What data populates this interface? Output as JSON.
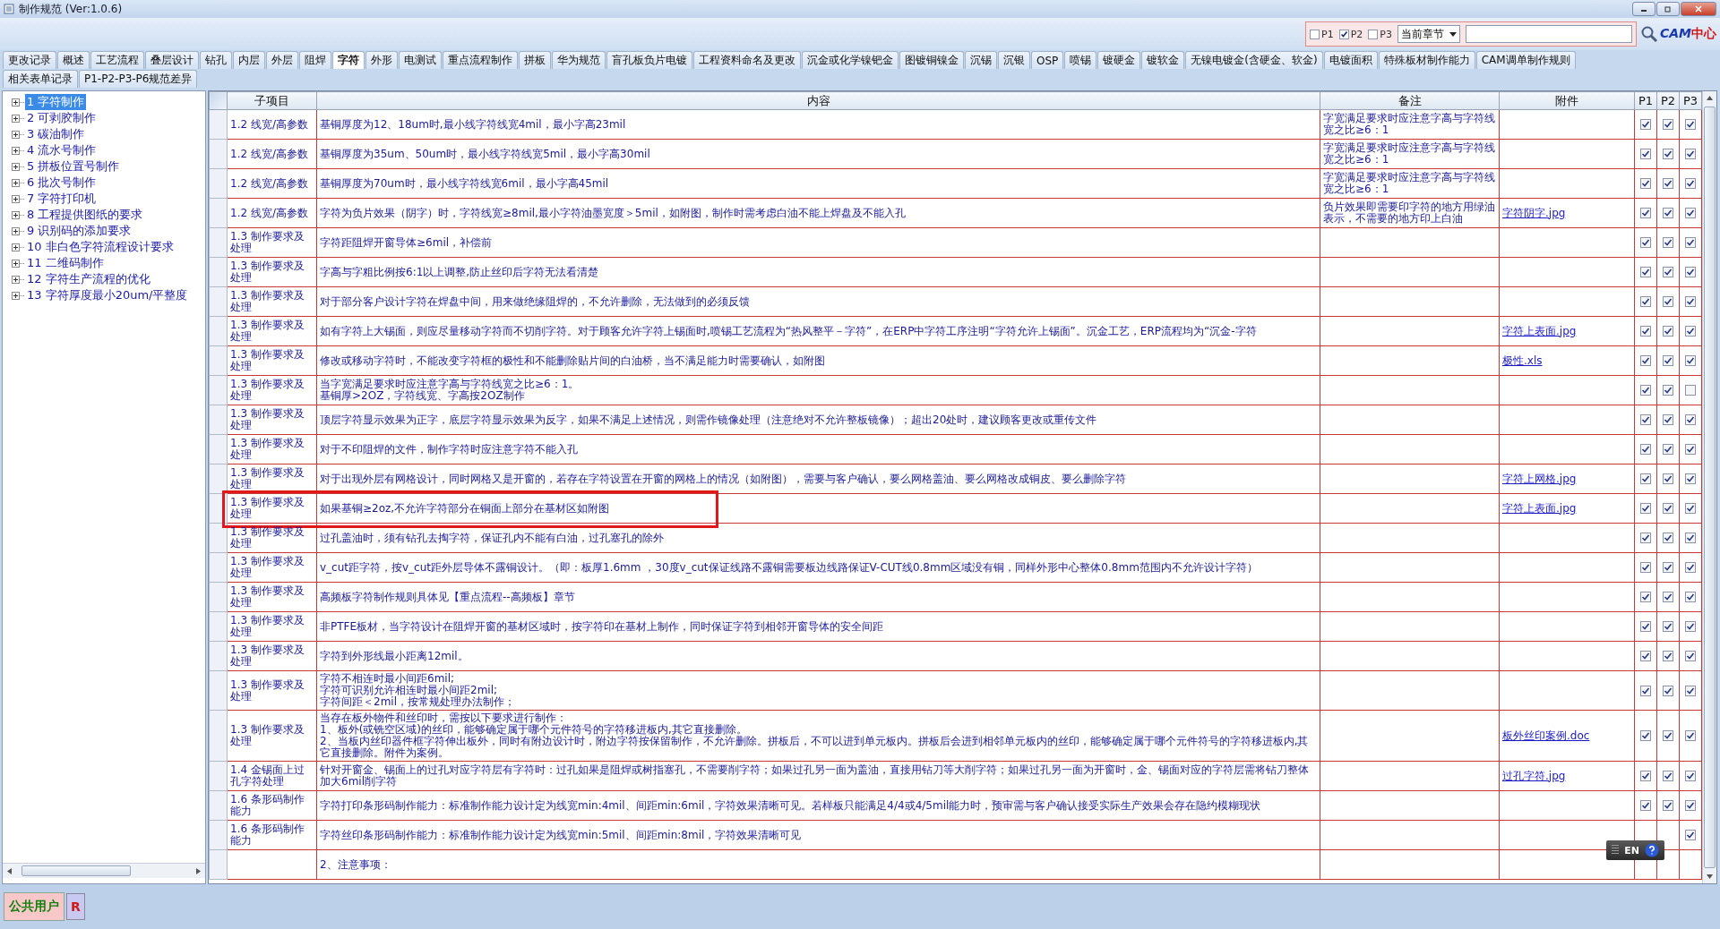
{
  "window": {
    "title": "制作规范 (Ver:1.0.6)"
  },
  "toolbar": {
    "filters": [
      {
        "label": "P1",
        "checked": false
      },
      {
        "label": "P2",
        "checked": true
      },
      {
        "label": "P3",
        "checked": false
      }
    ],
    "scope": "当前章节",
    "logo": {
      "main": "CAM",
      "sub": "中心"
    }
  },
  "tabs": [
    [
      {
        "label": "更改记录",
        "selected": false
      },
      {
        "label": "概述",
        "selected": false
      },
      {
        "label": "工艺流程",
        "selected": false
      },
      {
        "label": "叠层设计",
        "selected": false
      },
      {
        "label": "钻孔",
        "selected": false
      },
      {
        "label": "内层",
        "selected": false
      },
      {
        "label": "外层",
        "selected": false
      },
      {
        "label": "阻焊",
        "selected": false
      },
      {
        "label": "字符",
        "selected": true
      },
      {
        "label": "外形",
        "selected": false
      },
      {
        "label": "电测试",
        "selected": false
      },
      {
        "label": "重点流程制作",
        "selected": false
      },
      {
        "label": "拼板",
        "selected": false
      },
      {
        "label": "华为规范",
        "selected": false
      },
      {
        "label": "盲孔板负片电镀",
        "selected": false
      },
      {
        "label": "工程资料命名及更改",
        "selected": false
      },
      {
        "label": "沉金或化学镍钯金",
        "selected": false
      },
      {
        "label": "图镀铜镍金",
        "selected": false
      },
      {
        "label": "沉锡",
        "selected": false
      },
      {
        "label": "沉银",
        "selected": false
      },
      {
        "label": "OSP",
        "selected": false
      },
      {
        "label": "喷锡",
        "selected": false
      },
      {
        "label": "镀硬金",
        "selected": false
      },
      {
        "label": "镀软金",
        "selected": false
      },
      {
        "label": "无镍电镀金(含硬金、软金)",
        "selected": false
      },
      {
        "label": "电镀面积",
        "selected": false
      },
      {
        "label": "特殊板材制作能力",
        "selected": false
      },
      {
        "label": "CAM调单制作规则",
        "selected": false
      }
    ],
    [
      {
        "label": "相关表单记录",
        "selected": false
      },
      {
        "label": "P1-P2-P3-P6规范差异",
        "selected": false
      }
    ]
  ],
  "sidebar": {
    "items": [
      {
        "label": "1 字符制作",
        "selected": true,
        "expanded": false
      },
      {
        "label": "2 可剥胶制作",
        "selected": false,
        "expanded": false
      },
      {
        "label": "3 碳油制作",
        "selected": false,
        "expanded": false
      },
      {
        "label": "4 流水号制作",
        "selected": false,
        "expanded": false
      },
      {
        "label": "5 拼板位置号制作",
        "selected": false,
        "expanded": false
      },
      {
        "label": "6 批次号制作",
        "selected": false,
        "expanded": false
      },
      {
        "label": "7 字符打印机",
        "selected": false,
        "expanded": false
      },
      {
        "label": "8 工程提供图纸的要求",
        "selected": false,
        "expanded": false
      },
      {
        "label": "9 识别码的添加要求",
        "selected": false,
        "expanded": false
      },
      {
        "label": "10 非白色字符流程设计要求",
        "selected": false,
        "expanded": false
      },
      {
        "label": "11 二维码制作",
        "selected": false,
        "expanded": false
      },
      {
        "label": "12 字符生产流程的优化",
        "selected": false,
        "expanded": false
      },
      {
        "label": "13 字符厚度最小20um/平整度",
        "selected": false,
        "expanded": false
      }
    ]
  },
  "table": {
    "columns": [
      "子项目",
      "内容",
      "备注",
      "附件",
      "P1",
      "P2",
      "P3"
    ],
    "rows": [
      {
        "sub": "1.2 线宽/高参数",
        "content": "基铜厚度为12、18um时,最小线字符线宽4mil，最小字高23mil",
        "note": "字宽满足要求时应注意字高与字符线宽之比≥6：1",
        "p1": true,
        "p2": true,
        "p3": true,
        "highlighted": false
      },
      {
        "sub": "1.2 线宽/高参数",
        "content": "基铜厚度为35um、50um时，最小线字符线宽5mil，最小字高30mil",
        "note": "字宽满足要求时应注意字高与字符线宽之比≥6：1",
        "p1": true,
        "p2": true,
        "p3": true,
        "highlighted": false
      },
      {
        "sub": "1.2 线宽/高参数",
        "content": "基铜厚度为70um时，最小线字符线宽6mil，最小字高45mil",
        "note": "字宽满足要求时应注意字高与字符线宽之比≥6：1",
        "p1": true,
        "p2": true,
        "p3": true,
        "highlighted": false
      },
      {
        "sub": "1.2 线宽/高参数",
        "content": "字符为负片效果（阴字）时，字符线宽≥8mil,最小字符油墨宽度＞5mil，如附图，制作时需考虑白油不能上焊盘及不能入孔",
        "note": "负片效果即需要印字符的地方用绿油表示，不需要的地方印上白油",
        "attachment": "字符阴字.jpg",
        "p1": true,
        "p2": true,
        "p3": true,
        "highlighted": false
      },
      {
        "sub": "1.3 制作要求及处理",
        "content": "字符距阻焊开窗导体≥6mil，补偿前",
        "p1": true,
        "p2": true,
        "p3": true,
        "highlighted": false
      },
      {
        "sub": "1.3 制作要求及处理",
        "content": "字高与字粗比例按6:1以上调整,防止丝印后字符无法看清楚",
        "p1": true,
        "p2": true,
        "p3": true,
        "highlighted": false
      },
      {
        "sub": "1.3 制作要求及处理",
        "content": "对于部分客户设计字符在焊盘中间，用来做绝缘阻焊的，不允许删除，无法做到的必须反馈",
        "p1": true,
        "p2": true,
        "p3": true,
        "highlighted": false
      },
      {
        "sub": "1.3 制作要求及处理",
        "content": "如有字符上大锡面，则应尽量移动字符而不切削字符。对于顾客允许字符上锡面时,喷锡工艺流程为“热风整平－字符”，在ERP中字符工序注明“字符允许上锡面”。沉金工艺，ERP流程均为“沉金-字符",
        "attachment": "字符上表面.jpg",
        "p1": true,
        "p2": true,
        "p3": true,
        "highlighted": false
      },
      {
        "sub": "1.3 制作要求及处理",
        "content": "修改或移动字符时，不能改变字符框的极性和不能删除贴片间的白油桥，当不满足能力时需要确认，如附图",
        "attachment": "极性.xls",
        "p1": true,
        "p2": true,
        "p3": true,
        "highlighted": false
      },
      {
        "sub": "1.3 制作要求及处理",
        "lines": [
          "当字宽满足要求时应注意字高与字符线宽之比≥6：1。",
          "基铜厚>2OZ，字符线宽、字高按2OZ制作"
        ],
        "p1": true,
        "p2": true,
        "p3": false,
        "highlighted": false
      },
      {
        "sub": "1.3 制作要求及处理",
        "content": "顶层字符显示效果为正字，底层字符显示效果为反字，如果不满足上述情况，则需作镜像处理（注意绝对不允许整板镜像）；超出20处时，建议顾客更改或重传文件",
        "p1": true,
        "p2": true,
        "p3": true,
        "highlighted": false
      },
      {
        "sub": "1.3 制作要求及处理",
        "content": "对于不印阻焊的文件，制作字符时应注意字符不能入孔",
        "p1": true,
        "p2": true,
        "p3": true,
        "highlighted": false
      },
      {
        "sub": "1.3 制作要求及处理",
        "content": "对于出现外层有网格设计，同时网格又是开窗的，若存在字符设置在开窗的网格上的情况（如附图），需要与客户确认，要么网格盖油、要么网格改成铜皮、要么删除字符",
        "attachment": "字符上网格.jpg",
        "p1": true,
        "p2": true,
        "p3": true,
        "highlighted": false
      },
      {
        "sub": "1.3 制作要求及处理",
        "content": "如果基铜≥2oz,不允许字符部分在铜面上部分在基材区如附图",
        "attachment": "字符上表面.jpg",
        "p1": true,
        "p2": true,
        "p3": true,
        "highlighted": true
      },
      {
        "sub": "1.3 制作要求及处理",
        "content": "过孔盖油时，须有钻孔去掏字符，保证孔内不能有白油，过孔塞孔的除外",
        "p1": true,
        "p2": true,
        "p3": true,
        "highlighted": false
      },
      {
        "sub": "1.3 制作要求及处理",
        "content": "v_cut距字符，按v_cut距外层导体不露铜设计。（即：板厚1.6mm ，30度v_cut保证线路不露铜需要板边线路保证V-CUT线0.8mm区域没有铜，同样外形中心整体0.8mm范围内不允许设计字符）",
        "p1": true,
        "p2": true,
        "p3": true,
        "highlighted": false
      },
      {
        "sub": "1.3 制作要求及处理",
        "content": "高频板字符制作规则具体见【重点流程--高频板】章节",
        "p1": true,
        "p2": true,
        "p3": true,
        "highlighted": false
      },
      {
        "sub": "1.3 制作要求及处理",
        "content": "非PTFE板材，当字符设计在阻焊开窗的基材区域时，按字符印在基材上制作，同时保证字符到相邻开窗导体的安全间距",
        "p1": true,
        "p2": true,
        "p3": true,
        "highlighted": false
      },
      {
        "sub": "1.3 制作要求及处理",
        "content": "字符到外形线最小距离12mil。",
        "p1": true,
        "p2": true,
        "p3": true,
        "highlighted": false
      },
      {
        "sub": "1.3 制作要求及处理",
        "lines": [
          "字符不相连时最小间距6mil;",
          "字符可识别允许相连时最小间距2mil;",
          "字符间距＜2mil，按常规处理办法制作；"
        ],
        "p1": true,
        "p2": true,
        "p3": true,
        "highlighted": false
      },
      {
        "sub": "1.3 制作要求及处理",
        "lines": [
          "当存在板外物件和丝印时，需按以下要求进行制作：",
          "1、板外(或铣空区域)的丝印，能够确定属于哪个元件符号的字符移进板内,其它直接删除。",
          "2、当板内丝印器件框字符伸出板外，同时有附边设计时，附边字符按保留制作，不允许删除。拼板后，不可以进到单元板内。拼板后会进到相邻单元板内的丝印，能够确定属于哪个元件符号的字符移进板内,其它直接删除。附件为案例。"
        ],
        "attachment": "板外丝印案例.doc",
        "p1": true,
        "p2": true,
        "p3": true,
        "highlighted": false
      },
      {
        "sub": "1.4 金锡面上过孔字符处理",
        "content": "针对开窗金、锡面上的过孔对应字符层有字符时：过孔如果是阻焊或树指塞孔，不需要削字符；如果过孔另一面为盖油，直接用钻刀等大削字符；如果过孔另一面为开窗时，金、锡面对应的字符层需将钻刀整体加大6mil削字符",
        "attachment": "过孔字符.jpg",
        "p1": true,
        "p2": true,
        "p3": true,
        "highlighted": false
      },
      {
        "sub": "1.6 条形码制作能力",
        "content": "字符打印条形码制作能力：标准制作能力设计定为线宽min:4mil、间距min:6mil，字符效果清晰可见。若样板只能满足4/4或4/5mil能力时，预审需与客户确认接受实际生产效果会存在隐约模糊现状",
        "p1": true,
        "p2": true,
        "p3": true,
        "highlighted": false
      },
      {
        "sub": "1.6 条形码制作能力",
        "content": "字符丝印条形码制作能力：标准制作能力设计定为线宽min:5mil、间距min:8mil，字符效果清晰可见",
        "p3": true,
        "highlighted": false
      },
      {
        "content": "2、注意事项：",
        "highlighted": false
      }
    ]
  },
  "ime": {
    "label": "EN"
  },
  "status_bar": {
    "user": "公共用户",
    "mode": "R"
  }
}
